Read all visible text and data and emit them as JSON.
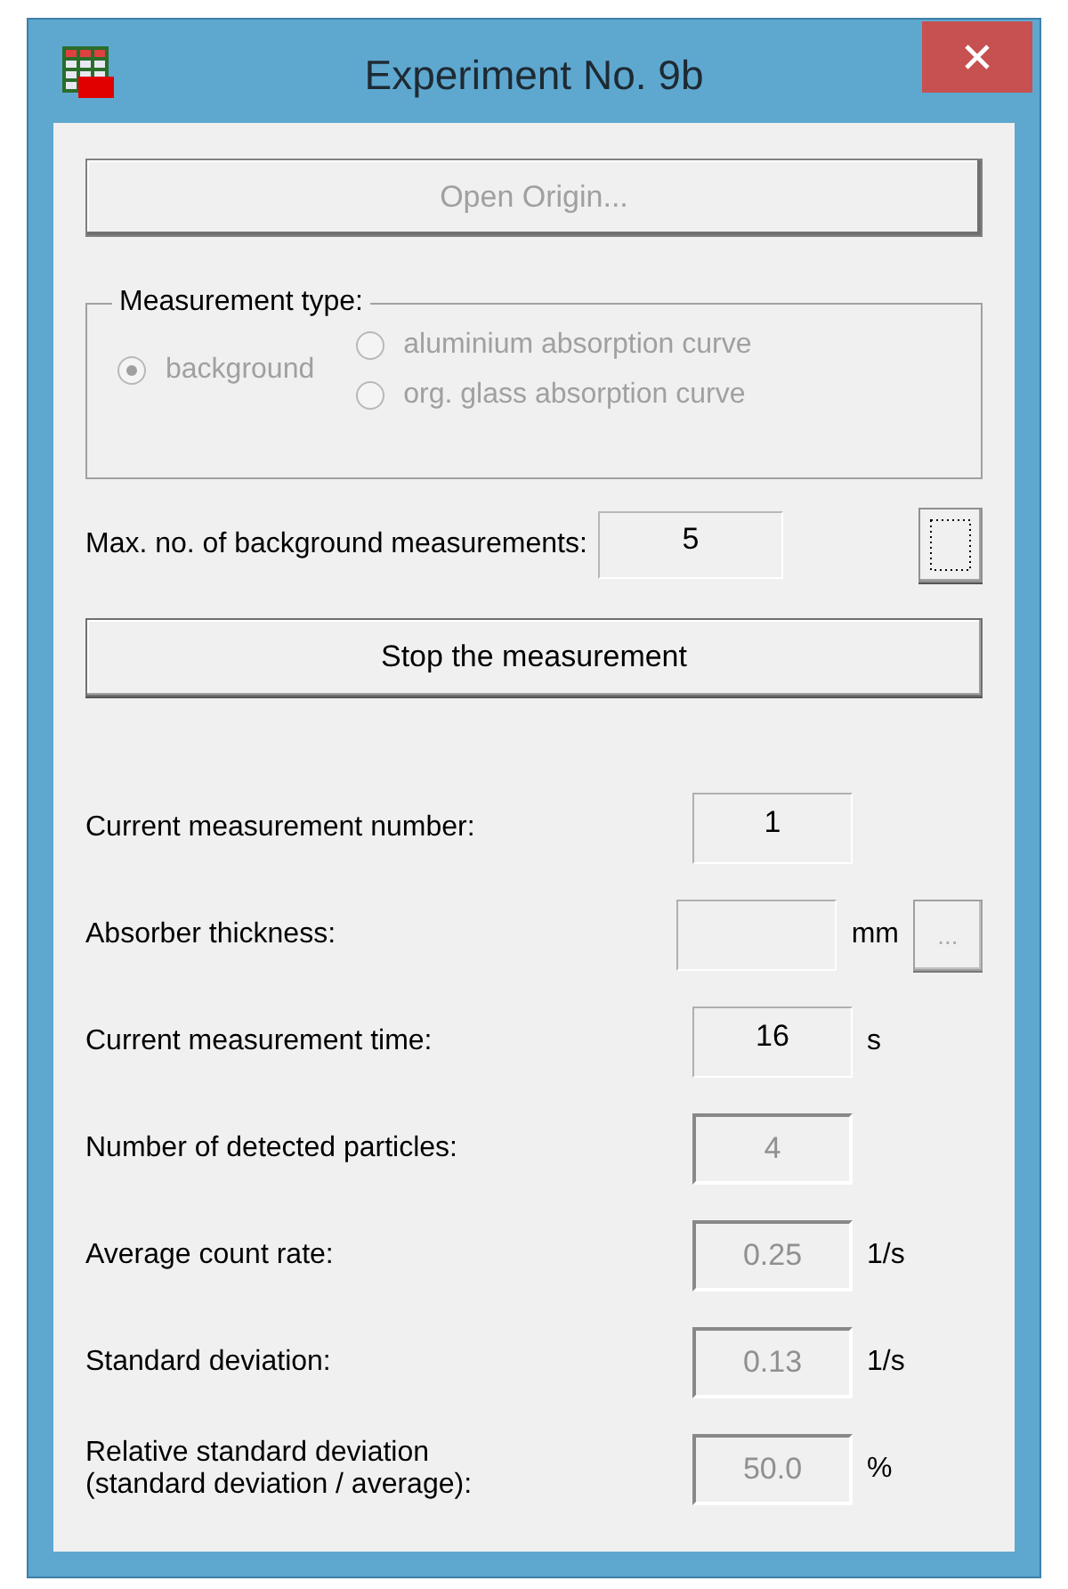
{
  "window": {
    "title": "Experiment No. 9b"
  },
  "open_button": {
    "label": "Open Origin...",
    "disabled": true
  },
  "measurement_type": {
    "label": "Measurement type:",
    "disabled": true,
    "options": [
      {
        "label": "background",
        "selected": true
      },
      {
        "label": "aluminium absorption curve",
        "selected": false
      },
      {
        "label": "org. glass absorption curve",
        "selected": false
      }
    ]
  },
  "max_measurements": {
    "label": "Max. no. of background measurements:",
    "value": "5",
    "focused_button": true
  },
  "stop_button": {
    "label": "Stop the measurement",
    "disabled": false
  },
  "readings": [
    {
      "label": "Current measurement number:",
      "value": "1",
      "disabled": false
    },
    {
      "label": "Absorber thickness:",
      "unit": "mm",
      "disabled": false,
      "button": {
        "label": "...",
        "disabled": true
      }
    },
    {
      "label": "Current measurement time:",
      "value": "16",
      "unit": "s",
      "disabled": false
    },
    {
      "label": "Number of detected particles:",
      "value": "4",
      "disabled": true
    },
    {
      "label": "Average count rate:",
      "value": "0.25",
      "unit": "1/s",
      "disabled": true
    },
    {
      "label": "Standard deviation:",
      "value": "0.13",
      "unit": "1/s",
      "disabled": true
    },
    {
      "label": "Relative standard deviation\n(standard deviation / average):",
      "value": "50.0",
      "unit": "%",
      "disabled": true
    }
  ]
}
